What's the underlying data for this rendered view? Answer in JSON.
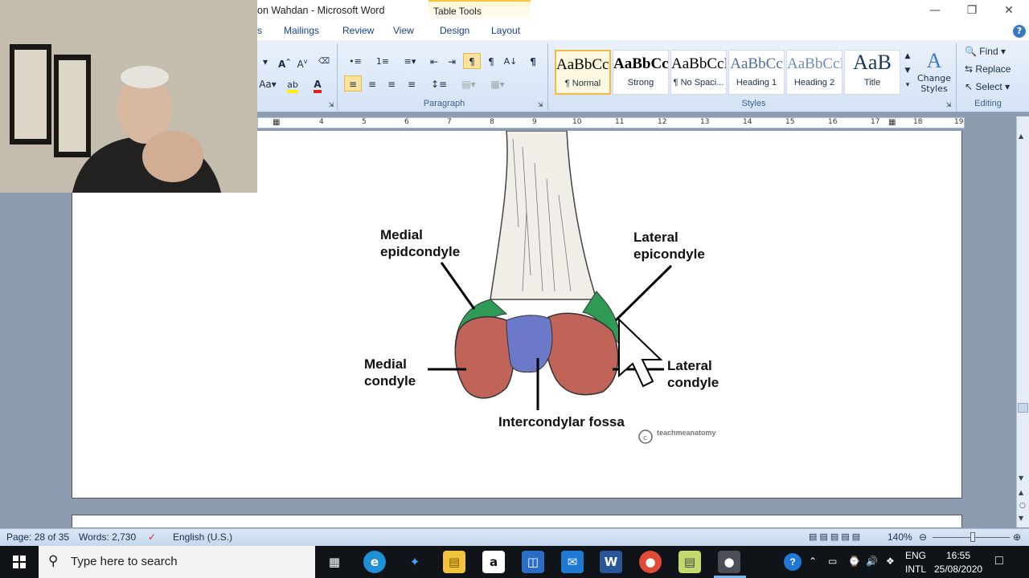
{
  "window": {
    "title": "on Wahdan - Microsoft Word",
    "context_tab": "Table Tools"
  },
  "tabs": [
    "s",
    "Mailings",
    "Review",
    "View",
    "Design",
    "Layout"
  ],
  "ribbon": {
    "paragraph_label": "Paragraph",
    "styles_label": "Styles",
    "editing_label": "Editing",
    "styles": [
      {
        "sample": "AaBbCcI",
        "name": "¶ Normal"
      },
      {
        "sample": "AaBbCc",
        "name": "Strong"
      },
      {
        "sample": "AaBbCcI",
        "name": "¶ No Spaci..."
      },
      {
        "sample": "AaBbCc",
        "name": "Heading 1"
      },
      {
        "sample": "AaBbCcI",
        "name": "Heading 2"
      },
      {
        "sample": "AaB",
        "name": "Title"
      }
    ],
    "change_styles": "Change Styles",
    "find": "Find",
    "replace": "Replace",
    "select": "Select",
    "font_case": "Aa"
  },
  "ruler": {
    "numbers": [
      "4",
      "5",
      "6",
      "7",
      "8",
      "9",
      "10",
      "11",
      "12",
      "13",
      "14",
      "15",
      "16",
      "17",
      "18",
      "19"
    ]
  },
  "figure": {
    "labels": {
      "medial_epicondyle": "Medial\nepidcondyle",
      "lateral_epicondyle": "Lateral\nepicondyle",
      "medial_condyle": "Medial\ncondyle",
      "lateral_condyle": "Lateral\ncondyle",
      "intercondylar_fossa": "Intercondylar fossa"
    },
    "watermark": "teachmeanatomy"
  },
  "statusbar": {
    "page": "Page: 28 of 35",
    "words": "Words: 2,730",
    "language": "English (U.S.)",
    "zoom": "140%"
  },
  "taskbar": {
    "search_placeholder": "Type here to search",
    "lang_top": "ENG",
    "lang_bottom": "INTL",
    "time": "16:55",
    "date": "25/08/2020"
  }
}
